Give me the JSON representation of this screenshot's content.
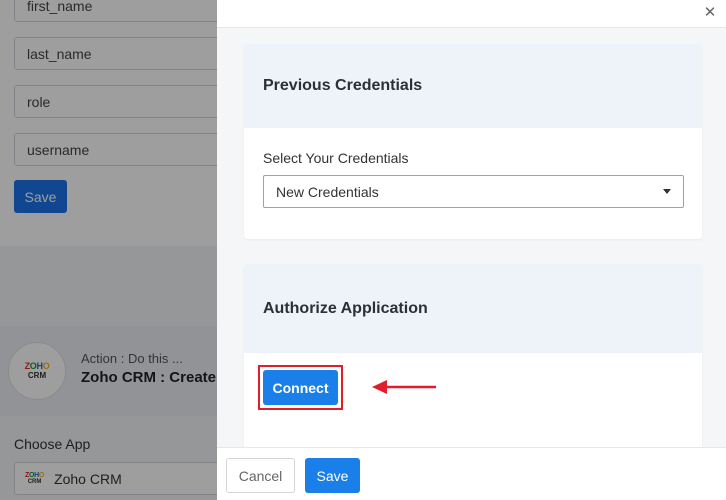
{
  "background": {
    "fields": [
      "first_name",
      "last_name",
      "role",
      "username"
    ],
    "save_label": "Save",
    "action": {
      "subtitle": "Action : Do this ...",
      "title": "Zoho CRM : Create",
      "logo_letters": [
        "Z",
        "O",
        "H",
        "O"
      ],
      "logo_sub": "CRM"
    },
    "choose_app_label": "Choose App",
    "selected_app": "Zoho CRM"
  },
  "drawer": {
    "close_icon": "close-icon",
    "previous_credentials": {
      "title": "Previous Credentials",
      "select_label": "Select Your Credentials",
      "selected": "New Credentials"
    },
    "authorize": {
      "title": "Authorize Application",
      "connect_label": "Connect",
      "highlight_color": "#e11d2b"
    },
    "footer": {
      "cancel_label": "Cancel",
      "save_label": "Save"
    }
  },
  "colors": {
    "primary": "#1a7fe8",
    "annotation": "#e11d2b"
  }
}
